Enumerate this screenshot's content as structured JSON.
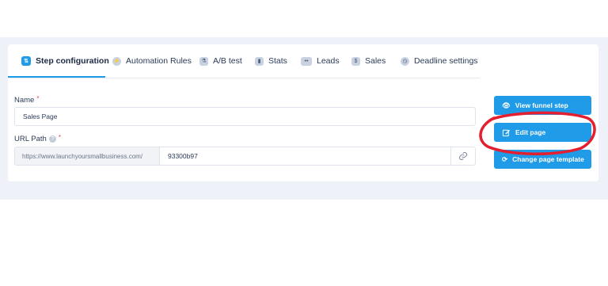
{
  "tabs": [
    {
      "label": "Step configuration",
      "icon": "sliders-icon",
      "active": true
    },
    {
      "label": "Automation Rules",
      "icon": "bolt-icon",
      "active": false
    },
    {
      "label": "A/B test",
      "icon": "flask-icon",
      "active": false
    },
    {
      "label": "Stats",
      "icon": "bar-chart-icon",
      "active": false
    },
    {
      "label": "Leads",
      "icon": "users-icon",
      "active": false
    },
    {
      "label": "Sales",
      "icon": "dollar-icon",
      "active": false
    },
    {
      "label": "Deadline settings",
      "icon": "clock-icon",
      "active": false
    }
  ],
  "form": {
    "name_label": "Name",
    "name_value": "Sales Page",
    "required_mark": "*",
    "url_label": "URL Path",
    "url_prefix": "https://www.launchyoursmallbusiness.com/",
    "url_value": "93300b97"
  },
  "actions": {
    "view_funnel_step": "View funnel step",
    "edit_page": "Edit page",
    "change_page_template": "Change page template"
  },
  "colors": {
    "accent": "#1f9be7",
    "annotation": "#e42030",
    "background_band": "#eef1f7"
  }
}
